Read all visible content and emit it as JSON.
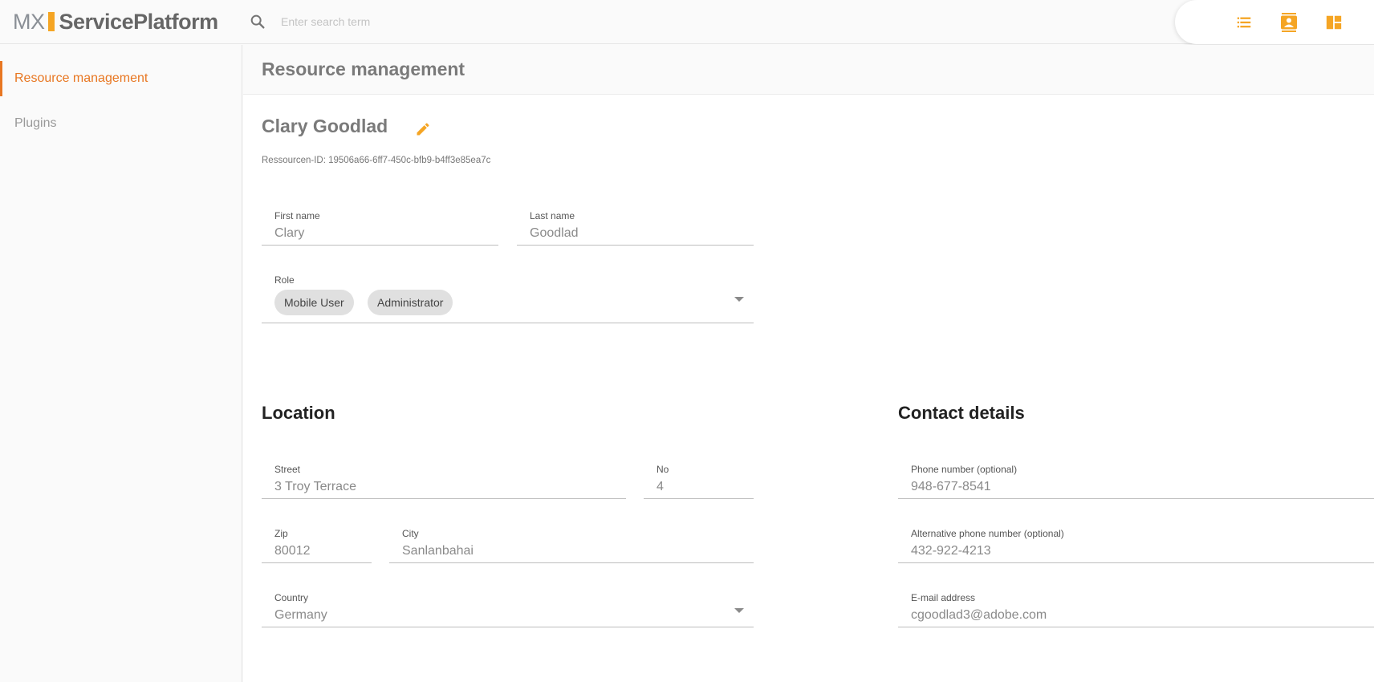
{
  "header": {
    "logo_mx": "MX",
    "logo_name": "ServicePlatform",
    "search_placeholder": "Enter search term",
    "icons": [
      "list-icon",
      "contact-card-icon",
      "dashboard-icon"
    ],
    "accent_color": "#f5a524"
  },
  "sidebar": {
    "items": [
      {
        "label": "Resource management",
        "active": true
      },
      {
        "label": "Plugins",
        "active": false
      }
    ],
    "active_color": "#e87722"
  },
  "page": {
    "title": "Resource management",
    "resource_name": "Clary Goodlad",
    "resource_id": "Ressourcen-ID: 19506a66-6ff7-450c-bfb9-b4ff3e85ea7c"
  },
  "form": {
    "first_name": {
      "label": "First name",
      "value": "Clary"
    },
    "last_name": {
      "label": "Last name",
      "value": "Goodlad"
    },
    "role": {
      "label": "Role",
      "chips": [
        "Mobile User",
        "Administrator"
      ]
    }
  },
  "location": {
    "title": "Location",
    "street": {
      "label": "Street",
      "value": "3 Troy Terrace"
    },
    "no": {
      "label": "No",
      "value": "4"
    },
    "zip": {
      "label": "Zip",
      "value": "80012"
    },
    "city": {
      "label": "City",
      "value": "Sanlanbahai"
    },
    "country": {
      "label": "Country",
      "value": "Germany"
    }
  },
  "contact": {
    "title": "Contact details",
    "phone": {
      "label": "Phone number (optional)",
      "value": "948-677-8541"
    },
    "alt_phone": {
      "label": "Alternative phone number (optional)",
      "value": "432-922-4213"
    },
    "email": {
      "label": "E-mail address",
      "value": "cgoodlad3@adobe.com"
    }
  }
}
